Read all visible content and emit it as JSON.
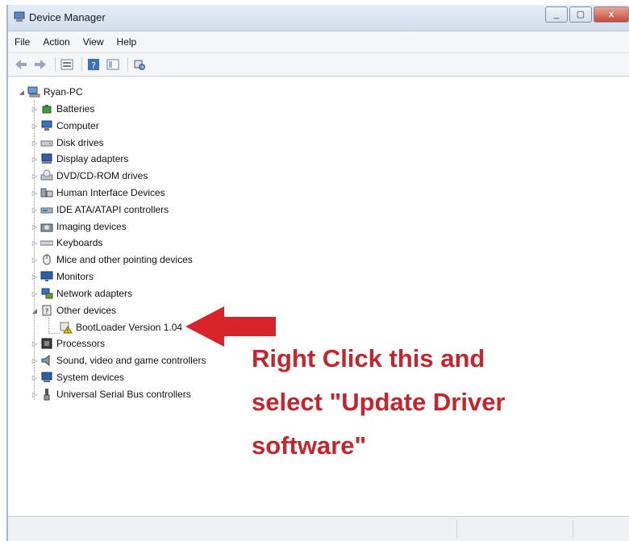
{
  "window": {
    "title": "Device Manager",
    "close_glyph": "x",
    "minimize_glyph": "_",
    "maximize_glyph": "▢"
  },
  "menu": [
    "File",
    "Action",
    "View",
    "Help"
  ],
  "toolbar": {
    "icons": [
      "back-arrow-icon",
      "forward-arrow-icon",
      "properties-icon",
      "help-icon",
      "view-icon",
      "scan-hardware-icon"
    ]
  },
  "tree": {
    "root": "Ryan-PC",
    "categories": [
      {
        "label": "Batteries",
        "icon": "battery-icon"
      },
      {
        "label": "Computer",
        "icon": "computer-icon"
      },
      {
        "label": "Disk drives",
        "icon": "disk-drive-icon"
      },
      {
        "label": "Display adapters",
        "icon": "display-adapter-icon"
      },
      {
        "label": "DVD/CD-ROM drives",
        "icon": "dvd-drive-icon"
      },
      {
        "label": "Human Interface Devices",
        "icon": "hid-icon"
      },
      {
        "label": "IDE ATA/ATAPI controllers",
        "icon": "ide-controller-icon"
      },
      {
        "label": "Imaging devices",
        "icon": "camera-icon"
      },
      {
        "label": "Keyboards",
        "icon": "keyboard-icon"
      },
      {
        "label": "Mice and other pointing devices",
        "icon": "mouse-icon"
      },
      {
        "label": "Monitors",
        "icon": "monitor-icon"
      },
      {
        "label": "Network adapters",
        "icon": "network-adapter-icon"
      },
      {
        "label": "Other devices",
        "icon": "other-devices-icon",
        "expanded": true,
        "children": [
          {
            "label": "BootLoader Version 1.04",
            "icon": "warning-device-icon"
          }
        ]
      },
      {
        "label": "Processors",
        "icon": "processor-icon"
      },
      {
        "label": "Sound, video and game controllers",
        "icon": "speaker-icon"
      },
      {
        "label": "System devices",
        "icon": "system-devices-icon"
      },
      {
        "label": "Universal Serial Bus controllers",
        "icon": "usb-icon"
      }
    ]
  },
  "annotation": {
    "line1": "Right Click this and",
    "line2": "select \"Update Driver",
    "line3": "software\"",
    "color": "#c8242b"
  }
}
